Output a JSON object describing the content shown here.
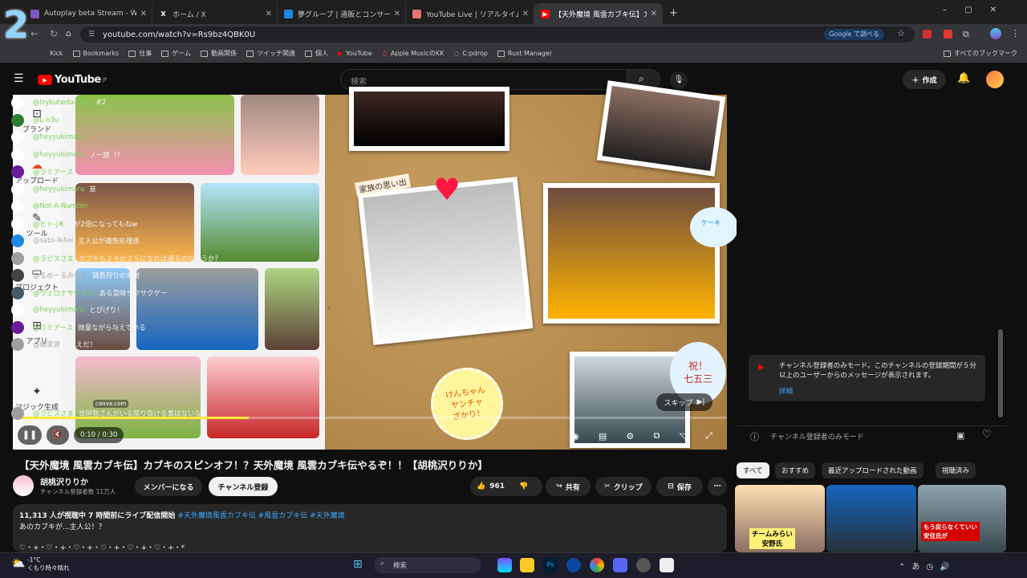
{
  "browser": {
    "tabs": [
      {
        "label": "Autoplay beta Stream - Watch Liv"
      },
      {
        "label": "ホーム / X"
      },
      {
        "label": "夢グループ | 通販とコンサート"
      },
      {
        "label": "YouTube Live | リアルタイムランキ"
      },
      {
        "label": "【天外魔境 風雲カブキ伝】カブキの"
      }
    ],
    "new_tab": "+",
    "url": "youtube.com/watch?v=Rs9bz4QBK0U",
    "google_button": "Google で調べる",
    "bookmarks": [
      "Kick",
      "Bookmarks",
      "仕事",
      "ゲーム",
      "動画関係",
      "ツイッチ関連",
      "個人",
      "YouTube",
      "Apple MusicのKK",
      "C:pdrop",
      "Rust Manager"
    ],
    "all_bookmarks": "すべてのブックマーク"
  },
  "youtube": {
    "logo": "YouTube",
    "logo_sup": "JP",
    "search_placeholder": "検索",
    "create_label": "作成"
  },
  "video": {
    "sidebar_items": [
      "ブランド",
      "アップロード",
      "ツール",
      "プロジェクト",
      "アプリ",
      "マジック生成"
    ],
    "scrap_text": "家族の思い出",
    "badge_text": "けんちゃん\nヤンチャ\nざかり！",
    "iwai_text": "祝！\n七五三",
    "cake_text": "ケーキ",
    "time": "0:10 / 0:30",
    "skip_label": "スキップ",
    "canva_tag": "canva.com",
    "progress": 0.33
  },
  "chat": {
    "messages": [
      {
        "author": "@trykutwda--s9q",
        "text": "#2",
        "av": "#ffffff"
      },
      {
        "author": "@L-n3u",
        "text": "#1",
        "av": "#2e7d32"
      },
      {
        "author": "@heyyukimaru",
        "text": "",
        "av": "#ffffff"
      },
      {
        "author": "@heyyukimaru",
        "text": "ノー題（?",
        "av": "#ffffff"
      },
      {
        "author": "@ラミアース",
        "text": "",
        "av": "#6a1b9a"
      },
      {
        "author": "@heyyukimaru",
        "text": "草",
        "av": "#ffffff"
      },
      {
        "author": "@Not-A-Number",
        "text": "",
        "av": "#ffffff"
      },
      {
        "author": "@ヒト-j木",
        "text": "1が2倍になってもねw",
        "av": "#ffffff"
      },
      {
        "author": "@sato-lk4ei",
        "text": "主人公が雑魚処理係",
        "av": "#1e88e5",
        "gray": true
      },
      {
        "author": "@ラピスさま",
        "text": "カブキも２４か２５になれば通るのだろうか？",
        "av": "#9e9e9e"
      },
      {
        "author": "@るめーるみやま",
        "text": "雑魚狩りの勇者",
        "av": "#444444",
        "gray": true
      },
      {
        "author": "@ヴェロナサウルス",
        "text": "ある意味サクサクゲー",
        "av": "#455a64"
      },
      {
        "author": "@heyyukimaru",
        "text": "とびげり！",
        "av": "#ffffff"
      },
      {
        "author": "@ラミアース",
        "text": "微量ながら与えている",
        "av": "#6a1b9a"
      },
      {
        "author": "@細潔習",
        "text": "4べえだ！",
        "av": "#9e9e9e",
        "gray": true
      }
    ],
    "notice": "チャンネル登録者のみモード。このチャンネルの登録期間が５分以上のユーザーからのメッセージが表示されます。",
    "notice_link": "詳細",
    "last_author": "@ラピスさま",
    "last_text": "世阿弥さんがいる限り負ける事はないな",
    "input_placeholder": "チャンネル登録者のみモード"
  },
  "below": {
    "title": "【天外魔境 風雲カブキ伝】カブキのスピンオフ！？天外魔境 風雲カブキ伝やるぞ！！【胡桃沢りりか】",
    "channel": "胡桃沢りりか",
    "subs": "チャンネル登録者数 11万人",
    "member_btn": "メンバーになる",
    "subscribe_btn": "チャンネル登録",
    "likes": "961",
    "share": "共有",
    "clip": "クリップ",
    "save": "保存",
    "views": "11,313 人が視聴中 7 時間前にライブ配信開始",
    "tags": "#天外魔境風雲カブキ伝 #風雲カブキ伝 #天外魔境",
    "desc1": "あのカブキが...主人公！？",
    "desc2": "♡・+・♡・+・♡・+・♡・+・♡・+・♡・+・*",
    "chips": [
      "すべて",
      "おすすめ",
      "最近アップロードされた動画",
      "視聴済み"
    ],
    "thumb1": "チームみらい\n安野氏",
    "thumb3": "もう戻らなくていい\n安住氏が"
  },
  "taskbar": {
    "weather_temp": "-1°C",
    "weather_text": "くもり時々晴れ",
    "search": "検索"
  }
}
